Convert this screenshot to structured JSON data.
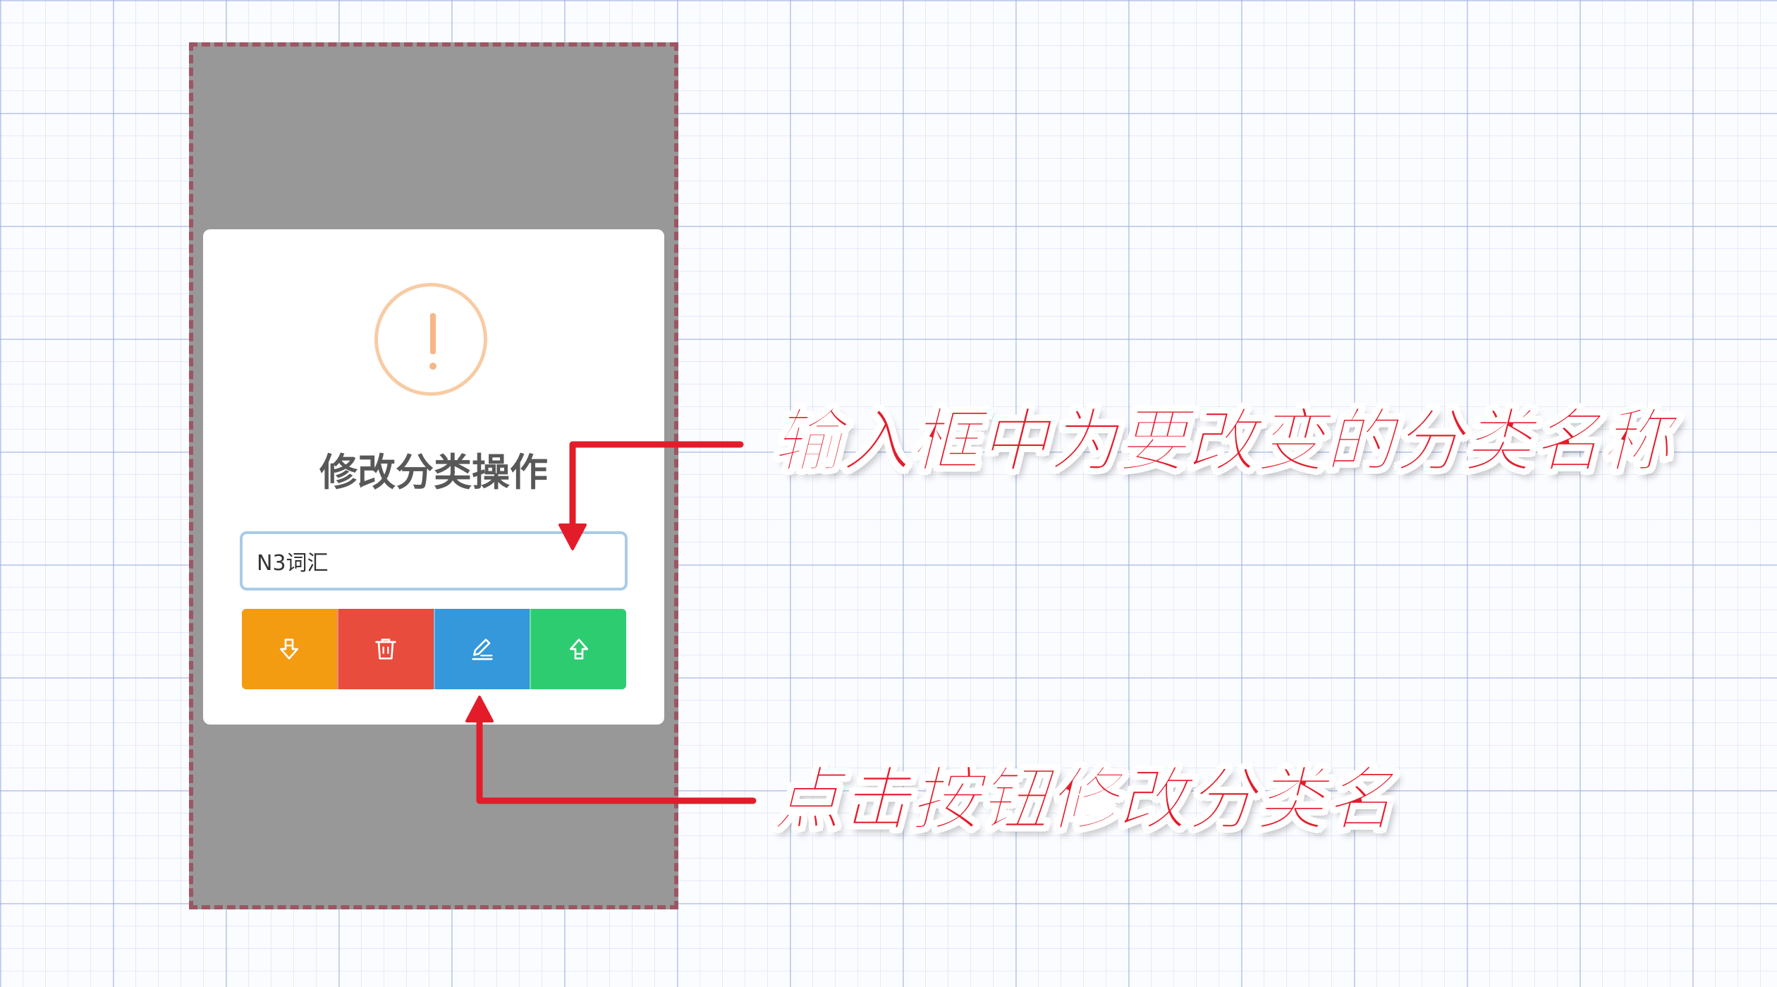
{
  "dialog": {
    "icon": "exclamation-circle-icon",
    "title": "修改分类操作",
    "input_value": "N3词汇",
    "buttons": [
      {
        "name": "move-down-button",
        "icon": "arrow-down-icon",
        "color": "#f39c12"
      },
      {
        "name": "delete-button",
        "icon": "trash-icon",
        "color": "#e74c3c"
      },
      {
        "name": "edit-button",
        "icon": "pencil-icon",
        "color": "#3498db"
      },
      {
        "name": "move-up-button",
        "icon": "arrow-up-icon",
        "color": "#2ecc71"
      }
    ]
  },
  "annotations": {
    "input_note": "输入框中为要改变的分类名称",
    "button_note": "点击按钮修改分类名"
  },
  "colors": {
    "overlay": "#989898",
    "frame_border": "#9c5663",
    "annotation_text": "#e41c2a",
    "warning_icon": "#f8cba3"
  }
}
